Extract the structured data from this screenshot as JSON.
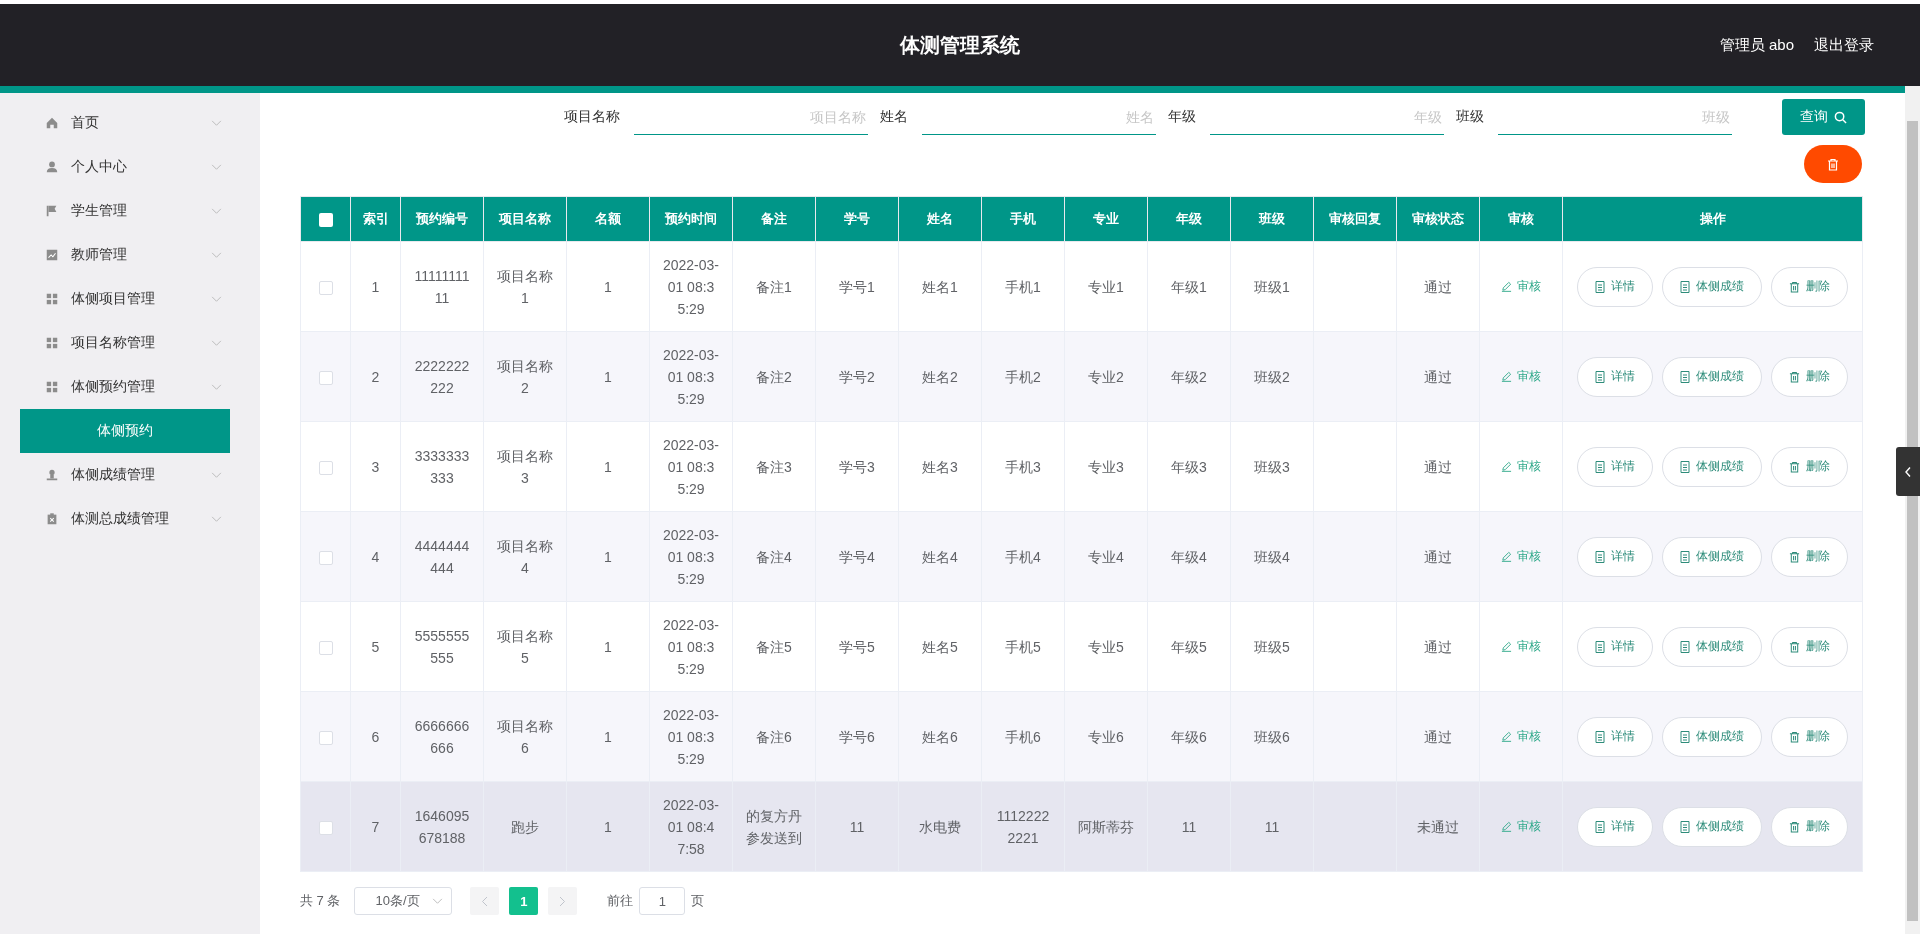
{
  "header": {
    "title": "体测管理系统",
    "user": "管理员 abo",
    "logout": "退出登录"
  },
  "sidebar": {
    "items": [
      {
        "label": "首页",
        "selected": false
      },
      {
        "label": "个人中心",
        "selected": false
      },
      {
        "label": "学生管理",
        "selected": false
      },
      {
        "label": "教师管理",
        "selected": false
      },
      {
        "label": "体侧项目管理",
        "selected": false
      },
      {
        "label": "项目名称管理",
        "selected": false
      },
      {
        "label": "体侧预约管理",
        "selected": false,
        "children": [
          {
            "label": "体侧预约",
            "selected": true
          }
        ]
      },
      {
        "label": "体侧成绩管理",
        "selected": false
      },
      {
        "label": "体测总成绩管理",
        "selected": false
      }
    ]
  },
  "search": {
    "fields": [
      {
        "label": "项目名称",
        "placeholder": "项目名称"
      },
      {
        "label": "姓名",
        "placeholder": "姓名"
      },
      {
        "label": "年级",
        "placeholder": "年级"
      },
      {
        "label": "班级",
        "placeholder": "班级"
      }
    ],
    "button": "查询"
  },
  "table": {
    "select_all_checked": false,
    "columns": [
      "索引",
      "预约编号",
      "项目名称",
      "名额",
      "预约时间",
      "备注",
      "学号",
      "姓名",
      "手机",
      "专业",
      "年级",
      "班级",
      "审核回复",
      "审核状态",
      "审核",
      "操作"
    ],
    "rows": [
      {
        "checked": false,
        "hovered": false,
        "cells": [
          "1",
          "1111111111",
          "项目名称1",
          "1",
          "2022-03-01 08:35:29",
          "备注1",
          "学号1",
          "姓名1",
          "手机1",
          "专业1",
          "年级1",
          "班级1",
          null,
          "通过"
        ],
        "audit": "审核",
        "actions": [
          {
            "kind": "doc",
            "label": "详情"
          },
          {
            "kind": "doc",
            "label": "体侧成绩"
          },
          {
            "kind": "trash",
            "label": "删除"
          }
        ]
      },
      {
        "checked": false,
        "hovered": false,
        "cells": [
          "2",
          "2222222222",
          "项目名称2",
          "1",
          "2022-03-01 08:35:29",
          "备注2",
          "学号2",
          "姓名2",
          "手机2",
          "专业2",
          "年级2",
          "班级2",
          null,
          "通过"
        ],
        "audit": "审核",
        "actions": [
          {
            "kind": "doc",
            "label": "详情"
          },
          {
            "kind": "doc",
            "label": "体侧成绩"
          },
          {
            "kind": "trash",
            "label": "删除"
          }
        ]
      },
      {
        "checked": false,
        "hovered": false,
        "cells": [
          "3",
          "3333333333",
          "项目名称3",
          "1",
          "2022-03-01 08:35:29",
          "备注3",
          "学号3",
          "姓名3",
          "手机3",
          "专业3",
          "年级3",
          "班级3",
          null,
          "通过"
        ],
        "audit": "审核",
        "actions": [
          {
            "kind": "doc",
            "label": "详情"
          },
          {
            "kind": "doc",
            "label": "体侧成绩"
          },
          {
            "kind": "trash",
            "label": "删除"
          }
        ]
      },
      {
        "checked": false,
        "hovered": false,
        "cells": [
          "4",
          "4444444444",
          "项目名称4",
          "1",
          "2022-03-01 08:35:29",
          "备注4",
          "学号4",
          "姓名4",
          "手机4",
          "专业4",
          "年级4",
          "班级4",
          null,
          "通过"
        ],
        "audit": "审核",
        "actions": [
          {
            "kind": "doc",
            "label": "详情"
          },
          {
            "kind": "doc",
            "label": "体侧成绩"
          },
          {
            "kind": "trash",
            "label": "删除"
          }
        ]
      },
      {
        "checked": false,
        "hovered": false,
        "cells": [
          "5",
          "5555555555",
          "项目名称5",
          "1",
          "2022-03-01 08:35:29",
          "备注5",
          "学号5",
          "姓名5",
          "手机5",
          "专业5",
          "年级5",
          "班级5",
          null,
          "通过"
        ],
        "audit": "审核",
        "actions": [
          {
            "kind": "doc",
            "label": "详情"
          },
          {
            "kind": "doc",
            "label": "体侧成绩"
          },
          {
            "kind": "trash",
            "label": "删除"
          }
        ]
      },
      {
        "checked": false,
        "hovered": false,
        "cells": [
          "6",
          "6666666666",
          "项目名称6",
          "1",
          "2022-03-01 08:35:29",
          "备注6",
          "学号6",
          "姓名6",
          "手机6",
          "专业6",
          "年级6",
          "班级6",
          null,
          "通过"
        ],
        "audit": "审核",
        "actions": [
          {
            "kind": "doc",
            "label": "详情"
          },
          {
            "kind": "doc",
            "label": "体侧成绩"
          },
          {
            "kind": "trash",
            "label": "删除"
          }
        ]
      },
      {
        "checked": false,
        "hovered": true,
        "cells": [
          "7",
          "1646095678188",
          "跑步",
          "1",
          "2022-03-01 08:47:58",
          "的复方丹参发送到",
          "11",
          "水电费",
          "11122222221",
          "阿斯蒂芬",
          "11",
          "11",
          null,
          "未通过"
        ],
        "audit": "审核",
        "actions": [
          {
            "kind": "doc",
            "label": "详情"
          },
          {
            "kind": "doc",
            "label": "体侧成绩"
          },
          {
            "kind": "trash",
            "label": "删除"
          }
        ]
      }
    ]
  },
  "pagination": {
    "total": "共 7 条",
    "page_size": "10条/页",
    "pages": [
      {
        "label": "1",
        "selected": true
      }
    ],
    "goto_label": "前往",
    "goto_value": "1",
    "goto_suffix": "页"
  }
}
